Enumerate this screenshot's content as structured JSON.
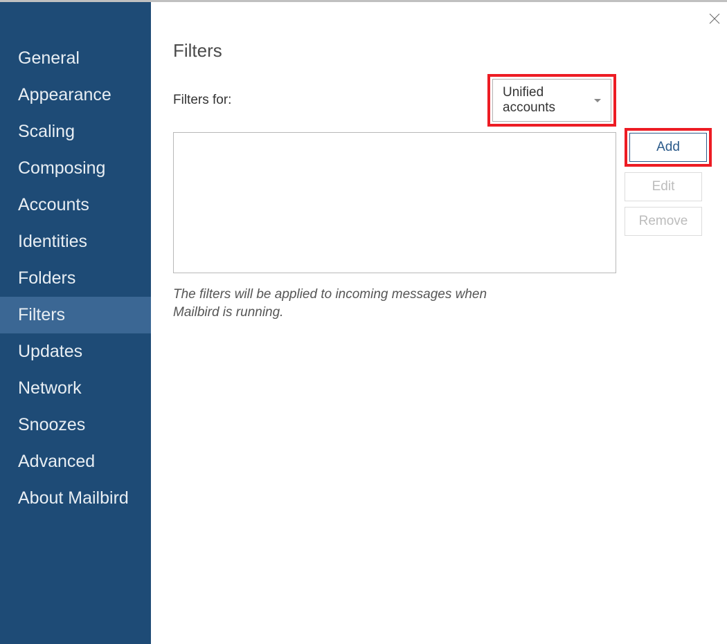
{
  "sidebar": {
    "items": [
      {
        "label": "General",
        "active": false
      },
      {
        "label": "Appearance",
        "active": false
      },
      {
        "label": "Scaling",
        "active": false
      },
      {
        "label": "Composing",
        "active": false
      },
      {
        "label": "Accounts",
        "active": false
      },
      {
        "label": "Identities",
        "active": false
      },
      {
        "label": "Folders",
        "active": false
      },
      {
        "label": "Filters",
        "active": true
      },
      {
        "label": "Updates",
        "active": false
      },
      {
        "label": "Network",
        "active": false
      },
      {
        "label": "Snoozes",
        "active": false
      },
      {
        "label": "Advanced",
        "active": false
      },
      {
        "label": "About Mailbird",
        "active": false
      }
    ]
  },
  "main": {
    "title": "Filters",
    "filters_for_label": "Filters for:",
    "dropdown_value": "Unified accounts",
    "buttons": {
      "add": "Add",
      "edit": "Edit",
      "remove": "Remove"
    },
    "hint": "The filters will be applied to incoming messages when Mailbird is running.",
    "highlight": {
      "dropdown": true,
      "add_button": true
    }
  },
  "colors": {
    "sidebar_bg": "#1e4b76",
    "sidebar_active": "#3b6794",
    "highlight": "#ed1c24",
    "btn_primary": "#2b5a8a"
  }
}
